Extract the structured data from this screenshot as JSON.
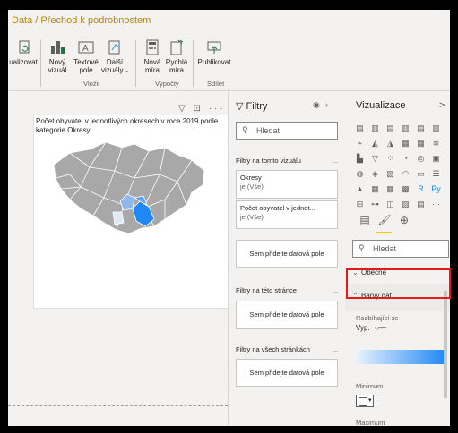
{
  "title": "Data / Přechod k podrobnostem",
  "ribbon": {
    "buttons": [
      {
        "label1": "ualizovat",
        "label2": ""
      },
      {
        "label1": "Nový",
        "label2": "vizuál"
      },
      {
        "label1": "Textové",
        "label2": "pole"
      },
      {
        "label1": "Další",
        "label2": "vizuály⌄"
      },
      {
        "label1": "Nová",
        "label2": "míra"
      },
      {
        "label1": "Rychlá",
        "label2": "míra"
      },
      {
        "label1": "Publikovat",
        "label2": ""
      }
    ],
    "groups": [
      "Vložit",
      "Výpočty",
      "Sdílet"
    ]
  },
  "visual": {
    "title": "Počet obyvatel v jednotlivých okresech v roce 2019 podle kategorie Okresy",
    "icons": "▽ ⊡ ···"
  },
  "filters": {
    "header": "Filtry",
    "search_placeholder": "Hledat",
    "section_visual": "Filtry na tomto vizuálu",
    "cards": [
      {
        "title": "Okresy",
        "value": "je (Vše)"
      },
      {
        "title": "Počet obyvatel v jednot...",
        "value": "je (Vše)"
      }
    ],
    "drop_label": "Sem přidejte datová pole",
    "section_page": "Filtry na této stránce",
    "section_all": "Filtry na všech stránkách",
    "dots": "..."
  },
  "viz": {
    "header": "Vizualizace",
    "arrow": ">",
    "search_placeholder": "Hledat",
    "acc_general": "Obecné",
    "acc_colors": "Barvy dat",
    "diverging_label": "Rozbíhající se",
    "toggle_label": "Vyp.",
    "minimum_label": "Minimum",
    "maximum_label": "Maximum",
    "r_icon": "R",
    "py_icon": "Py",
    "more": "···"
  },
  "colors": {
    "title_text": "#b8860b",
    "map_gray": "#a8a8a8",
    "map_blue": "#1f88f5",
    "highlight": "#e21b1b"
  }
}
